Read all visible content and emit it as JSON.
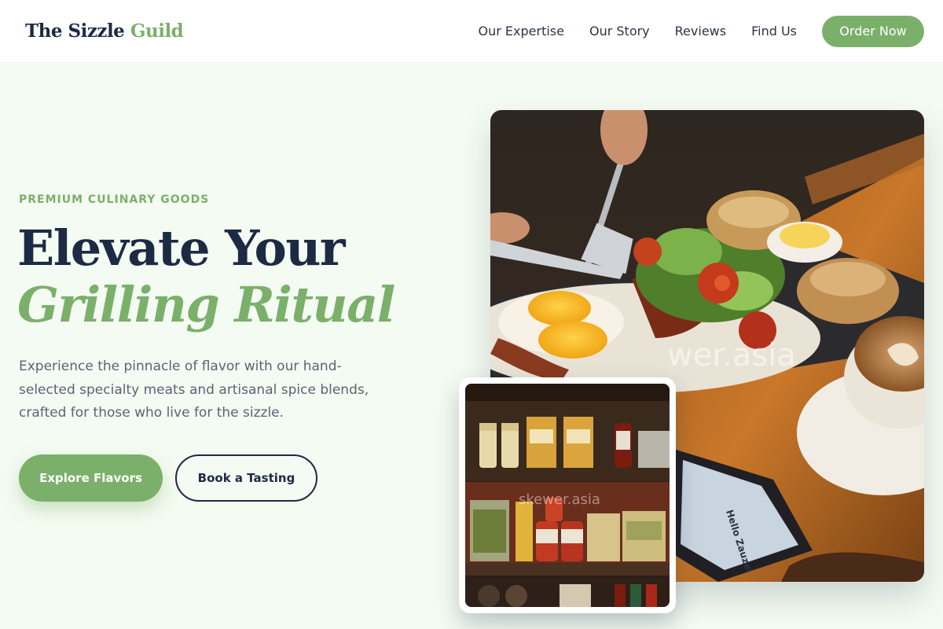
{
  "brand": {
    "name_main": "The Sizzle",
    "name_accent": "Guild"
  },
  "nav": {
    "links": [
      "Our Expertise",
      "Our Story",
      "Reviews",
      "Find Us"
    ],
    "cta": "Order Now"
  },
  "hero": {
    "eyebrow": "PREMIUM CULINARY GOODS",
    "title_line1": "Elevate Your",
    "title_line2": "Grilling Ritual",
    "lead": "Experience the pinnacle of flavor with our hand-selected specialty meats and artisanal spice blends, crafted for those who live for the sizzle.",
    "primary_button": "Explore Flavors",
    "secondary_button": "Book a Tasting"
  },
  "images": {
    "main_watermark": "wer.asia",
    "small_watermark": "skewer.asia",
    "phone_text": "Hello Zauzel"
  },
  "colors": {
    "accent": "#7bb06a",
    "navy": "#1c2a44",
    "background": "#f4fbf2"
  }
}
